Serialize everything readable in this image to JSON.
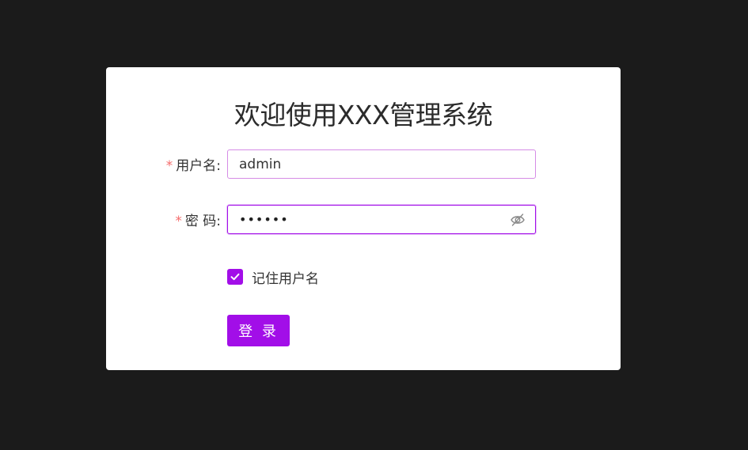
{
  "login": {
    "title": "欢迎使用XXX管理系统",
    "required_mark": "*",
    "username": {
      "label": "用户名:",
      "value": "admin"
    },
    "password": {
      "label": "密 码:",
      "masked_value": "••••••",
      "toggle_icon": "eye-off-icon"
    },
    "remember": {
      "label": "记住用户名",
      "checked": true
    },
    "submit_label": "登 录"
  },
  "colors": {
    "background": "#1b1b1b",
    "card": "#ffffff",
    "accent": "#a20ee8",
    "required": "#f56c6c"
  }
}
